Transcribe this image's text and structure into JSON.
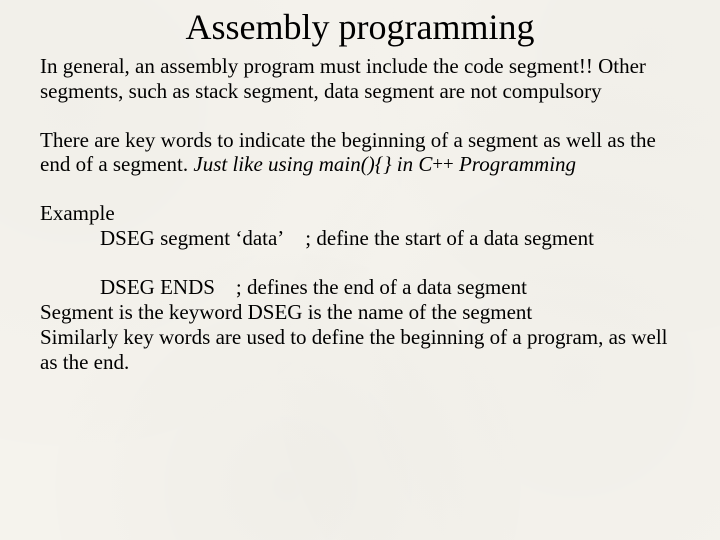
{
  "title": "Assembly programming",
  "para1": {
    "t1": "In general, an assembly program must include the code segment!! Other segments, such as stack segment, data segment are not compulsory"
  },
  "para2": {
    "t1": "There are key words to indicate the beginning of a segment as well as the end of a segment. ",
    "em1": "Just like using main(){} in C",
    "plus": "++",
    "em2": " Programming"
  },
  "para3": {
    "label": "Example",
    "line1": "DSEG segment ‘data’    ; define the start of a data segment",
    "line2": "DSEG ENDS    ; defines the end of a data segment",
    "t1": "Segment is the keyword DSEG is the name of the segment",
    "t2": "Similarly key words are used to define the beginning of a program, as well as the end."
  }
}
